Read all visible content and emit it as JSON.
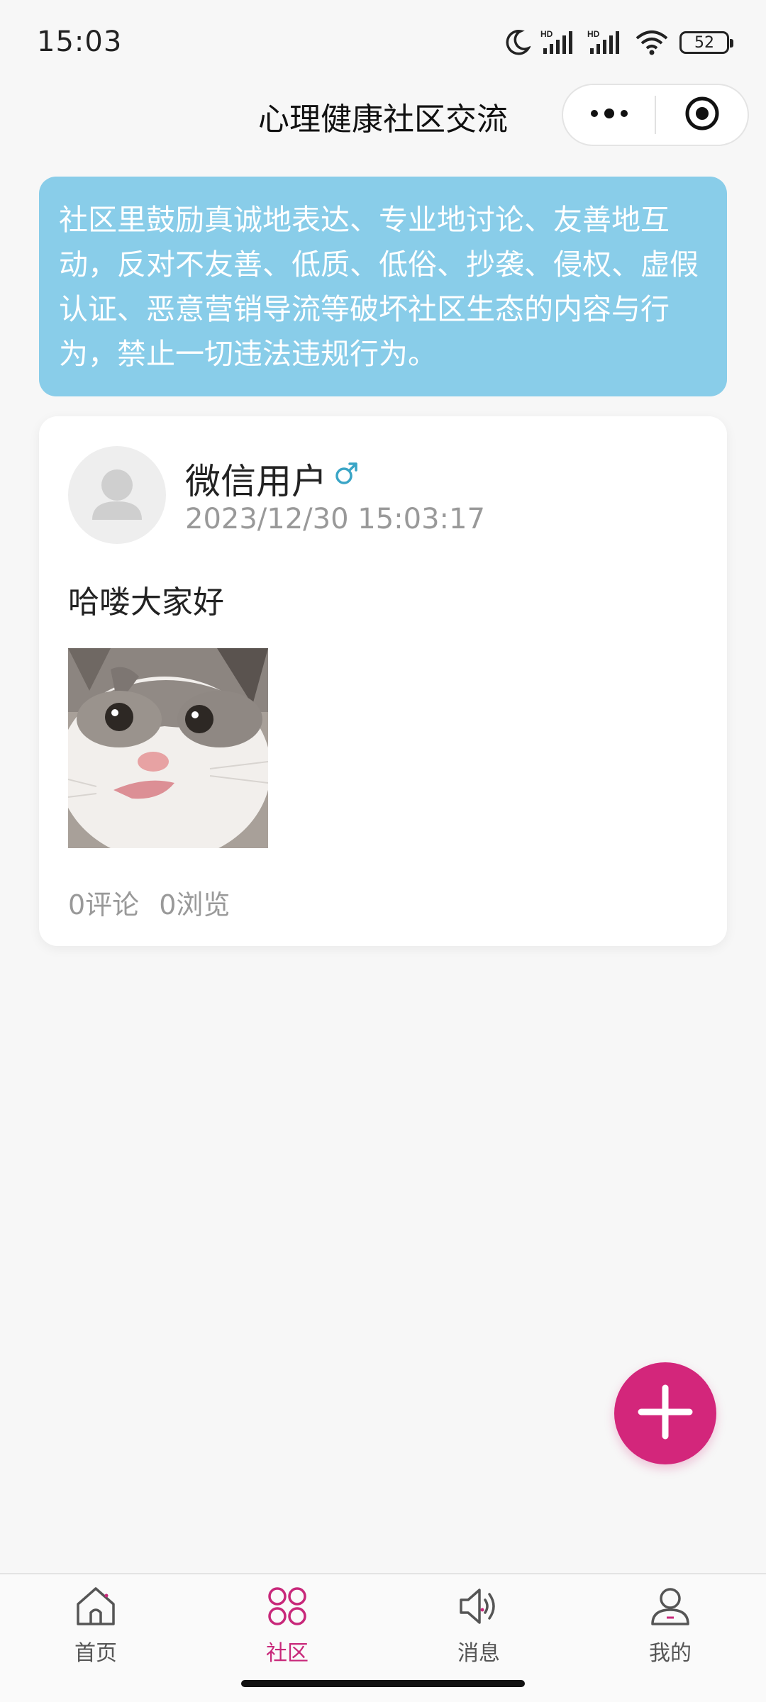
{
  "status_bar": {
    "time": "15:03",
    "battery": "52",
    "icons": [
      "moon-icon",
      "hd-signal-icon",
      "hd-signal-icon",
      "wifi-icon",
      "battery-icon"
    ]
  },
  "nav": {
    "title": "心理健康社区交流",
    "more_icon": "more-dots-icon",
    "close_icon": "target-circle-icon"
  },
  "notice": {
    "text": "社区里鼓励真诚地表达、专业地讨论、友善地互动，反对不友善、低质、低俗、抄袭、侵权、虚假认证、恶意营销导流等破坏社区生态的内容与行为，禁止一切违法违规行为。"
  },
  "post": {
    "user_name": "微信用户",
    "gender_icon": "male-icon",
    "time": "2023/12/30 15:03:17",
    "text": "哈喽大家好",
    "image": "cat-photo",
    "comments": "0评论",
    "views": "0浏览"
  },
  "fab": {
    "icon": "plus-icon"
  },
  "tabs": [
    {
      "label": "首页",
      "icon": "home-icon",
      "active": false
    },
    {
      "label": "社区",
      "icon": "community-icon",
      "active": true
    },
    {
      "label": "消息",
      "icon": "speaker-icon",
      "active": false
    },
    {
      "label": "我的",
      "icon": "user-icon",
      "active": false
    }
  ],
  "colors": {
    "accent": "#d3267b",
    "notice_bg": "#89cde9",
    "gender": "#3aa5c6",
    "muted_text": "#999999"
  }
}
